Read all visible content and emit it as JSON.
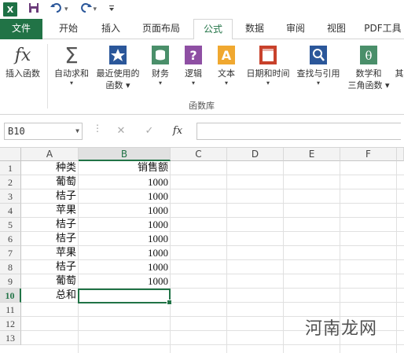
{
  "titlebar": {
    "app_icon": "X",
    "qat_items": [
      "save-icon",
      "undo-icon",
      "redo-icon",
      "customize-icon"
    ]
  },
  "tabs": [
    {
      "label": "文件",
      "kind": "file"
    },
    {
      "label": "开始"
    },
    {
      "label": "插入"
    },
    {
      "label": "页面布局"
    },
    {
      "label": "公式",
      "active": true
    },
    {
      "label": "数据"
    },
    {
      "label": "审阅"
    },
    {
      "label": "视图"
    },
    {
      "label": "PDF工具"
    }
  ],
  "ribbon": {
    "insert_function": "插入函数",
    "autosum": "自动求和",
    "recent_line1": "最近使用的",
    "recent_line2": "函数",
    "financial": "财务",
    "logical": "逻辑",
    "text": "文本",
    "datetime": "日期和时间",
    "lookup": "查找与引用",
    "math_line1": "数学和",
    "math_line2": "三角函数",
    "more": "其",
    "group_label": "函数库",
    "dropdown_glyph": "▾"
  },
  "formula_bar": {
    "name_box": "B10",
    "cancel": "✕",
    "confirm": "✓",
    "fx": "fx",
    "formula": ""
  },
  "grid": {
    "columns": [
      "A",
      "B",
      "C",
      "D",
      "E",
      "F"
    ],
    "rows": [
      "1",
      "2",
      "3",
      "4",
      "5",
      "6",
      "7",
      "8",
      "9",
      "10",
      "11",
      "12",
      "13"
    ],
    "selected_cell": "B10",
    "cells": [
      {
        "a": "种类",
        "b": "销售额"
      },
      {
        "a": "葡萄",
        "b": "1000"
      },
      {
        "a": "桔子",
        "b": "1000"
      },
      {
        "a": "苹果",
        "b": "1000"
      },
      {
        "a": "桔子",
        "b": "1000"
      },
      {
        "a": "桔子",
        "b": "1000"
      },
      {
        "a": "苹果",
        "b": "1000"
      },
      {
        "a": "桔子",
        "b": "1000"
      },
      {
        "a": "葡萄",
        "b": "1000"
      },
      {
        "a": "总和",
        "b": ""
      }
    ]
  },
  "watermark": "河南龙网",
  "colors": {
    "accent": "#217346"
  }
}
